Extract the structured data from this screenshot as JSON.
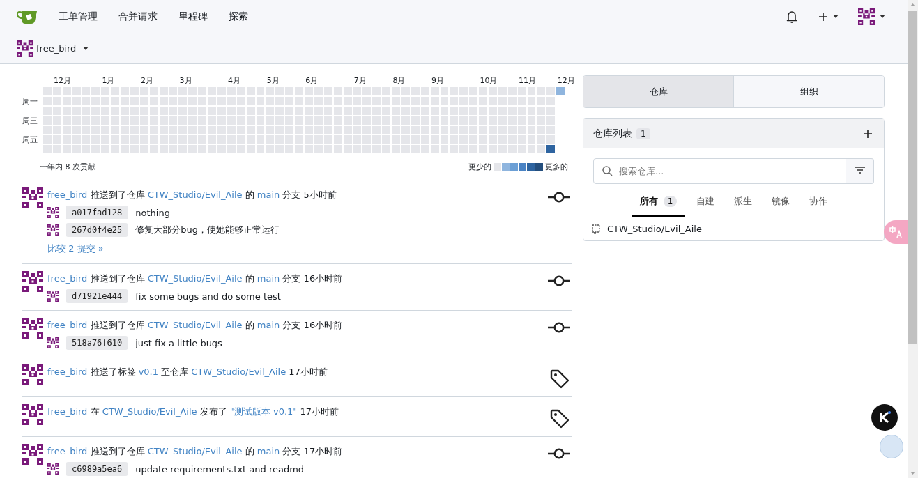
{
  "nav": {
    "items": [
      "工单管理",
      "合并请求",
      "里程碑",
      "探索"
    ]
  },
  "context": {
    "user": "free_bird"
  },
  "heatmap": {
    "weekdays": [
      {
        "label": "周一"
      },
      {
        "label": "周三"
      },
      {
        "label": "周五"
      }
    ],
    "legend": [
      {
        "color": "#e5e6ea"
      },
      {
        "color": "#8fb5de"
      },
      {
        "color": "#6b9fd5"
      },
      {
        "color": "#4a83c4"
      },
      {
        "color": "#2e64a0"
      },
      {
        "color": "#244e7d"
      }
    ],
    "weeks": [
      {
        "cells": [
          {
            "color": "#e5e6ea"
          },
          {
            "color": "#e5e6ea"
          },
          {
            "color": "#e5e6ea"
          },
          {
            "color": "#e5e6ea"
          },
          {
            "color": "#e5e6ea"
          },
          {
            "color": "#e5e6ea"
          },
          {
            "color": "#e5e6ea"
          }
        ]
      },
      {
        "month": "12月",
        "cells": [
          {
            "color": "#e5e6ea"
          },
          {
            "color": "#e5e6ea"
          },
          {
            "color": "#e5e6ea"
          },
          {
            "color": "#e5e6ea"
          },
          {
            "color": "#e5e6ea"
          },
          {
            "color": "#e5e6ea"
          },
          {
            "color": "#e5e6ea"
          }
        ]
      },
      {
        "cells": [
          {
            "color": "#e5e6ea"
          },
          {
            "color": "#e5e6ea"
          },
          {
            "color": "#e5e6ea"
          },
          {
            "color": "#e5e6ea"
          },
          {
            "color": "#e5e6ea"
          },
          {
            "color": "#e5e6ea"
          },
          {
            "color": "#e5e6ea"
          }
        ]
      },
      {
        "cells": [
          {
            "color": "#e5e6ea"
          },
          {
            "color": "#e5e6ea"
          },
          {
            "color": "#e5e6ea"
          },
          {
            "color": "#e5e6ea"
          },
          {
            "color": "#e5e6ea"
          },
          {
            "color": "#e5e6ea"
          },
          {
            "color": "#e5e6ea"
          }
        ]
      },
      {
        "cells": [
          {
            "color": "#e5e6ea"
          },
          {
            "color": "#e5e6ea"
          },
          {
            "color": "#e5e6ea"
          },
          {
            "color": "#e5e6ea"
          },
          {
            "color": "#e5e6ea"
          },
          {
            "color": "#e5e6ea"
          },
          {
            "color": "#e5e6ea"
          }
        ]
      },
      {
        "cells": [
          {
            "color": "#e5e6ea"
          },
          {
            "color": "#e5e6ea"
          },
          {
            "color": "#e5e6ea"
          },
          {
            "color": "#e5e6ea"
          },
          {
            "color": "#e5e6ea"
          },
          {
            "color": "#e5e6ea"
          },
          {
            "color": "#e5e6ea"
          }
        ]
      },
      {
        "month": "1月",
        "cells": [
          {
            "color": "#e5e6ea"
          },
          {
            "color": "#e5e6ea"
          },
          {
            "color": "#e5e6ea"
          },
          {
            "color": "#e5e6ea"
          },
          {
            "color": "#e5e6ea"
          },
          {
            "color": "#e5e6ea"
          },
          {
            "color": "#e5e6ea"
          }
        ]
      },
      {
        "cells": [
          {
            "color": "#e5e6ea"
          },
          {
            "color": "#e5e6ea"
          },
          {
            "color": "#e5e6ea"
          },
          {
            "color": "#e5e6ea"
          },
          {
            "color": "#e5e6ea"
          },
          {
            "color": "#e5e6ea"
          },
          {
            "color": "#e5e6ea"
          }
        ]
      },
      {
        "cells": [
          {
            "color": "#e5e6ea"
          },
          {
            "color": "#e5e6ea"
          },
          {
            "color": "#e5e6ea"
          },
          {
            "color": "#e5e6ea"
          },
          {
            "color": "#e5e6ea"
          },
          {
            "color": "#e5e6ea"
          },
          {
            "color": "#e5e6ea"
          }
        ]
      },
      {
        "cells": [
          {
            "color": "#e5e6ea"
          },
          {
            "color": "#e5e6ea"
          },
          {
            "color": "#e5e6ea"
          },
          {
            "color": "#e5e6ea"
          },
          {
            "color": "#e5e6ea"
          },
          {
            "color": "#e5e6ea"
          },
          {
            "color": "#e5e6ea"
          }
        ]
      },
      {
        "month": "2月",
        "cells": [
          {
            "color": "#e5e6ea"
          },
          {
            "color": "#e5e6ea"
          },
          {
            "color": "#e5e6ea"
          },
          {
            "color": "#e5e6ea"
          },
          {
            "color": "#e5e6ea"
          },
          {
            "color": "#e5e6ea"
          },
          {
            "color": "#e5e6ea"
          }
        ]
      },
      {
        "cells": [
          {
            "color": "#e5e6ea"
          },
          {
            "color": "#e5e6ea"
          },
          {
            "color": "#e5e6ea"
          },
          {
            "color": "#e5e6ea"
          },
          {
            "color": "#e5e6ea"
          },
          {
            "color": "#e5e6ea"
          },
          {
            "color": "#e5e6ea"
          }
        ]
      },
      {
        "cells": [
          {
            "color": "#e5e6ea"
          },
          {
            "color": "#e5e6ea"
          },
          {
            "color": "#e5e6ea"
          },
          {
            "color": "#e5e6ea"
          },
          {
            "color": "#e5e6ea"
          },
          {
            "color": "#e5e6ea"
          },
          {
            "color": "#e5e6ea"
          }
        ]
      },
      {
        "cells": [
          {
            "color": "#e5e6ea"
          },
          {
            "color": "#e5e6ea"
          },
          {
            "color": "#e5e6ea"
          },
          {
            "color": "#e5e6ea"
          },
          {
            "color": "#e5e6ea"
          },
          {
            "color": "#e5e6ea"
          },
          {
            "color": "#e5e6ea"
          }
        ]
      },
      {
        "month": "3月",
        "cells": [
          {
            "color": "#e5e6ea"
          },
          {
            "color": "#e5e6ea"
          },
          {
            "color": "#e5e6ea"
          },
          {
            "color": "#e5e6ea"
          },
          {
            "color": "#e5e6ea"
          },
          {
            "color": "#e5e6ea"
          },
          {
            "color": "#e5e6ea"
          }
        ]
      },
      {
        "cells": [
          {
            "color": "#e5e6ea"
          },
          {
            "color": "#e5e6ea"
          },
          {
            "color": "#e5e6ea"
          },
          {
            "color": "#e5e6ea"
          },
          {
            "color": "#e5e6ea"
          },
          {
            "color": "#e5e6ea"
          },
          {
            "color": "#e5e6ea"
          }
        ]
      },
      {
        "cells": [
          {
            "color": "#e5e6ea"
          },
          {
            "color": "#e5e6ea"
          },
          {
            "color": "#e5e6ea"
          },
          {
            "color": "#e5e6ea"
          },
          {
            "color": "#e5e6ea"
          },
          {
            "color": "#e5e6ea"
          },
          {
            "color": "#e5e6ea"
          }
        ]
      },
      {
        "cells": [
          {
            "color": "#e5e6ea"
          },
          {
            "color": "#e5e6ea"
          },
          {
            "color": "#e5e6ea"
          },
          {
            "color": "#e5e6ea"
          },
          {
            "color": "#e5e6ea"
          },
          {
            "color": "#e5e6ea"
          },
          {
            "color": "#e5e6ea"
          }
        ]
      },
      {
        "cells": [
          {
            "color": "#e5e6ea"
          },
          {
            "color": "#e5e6ea"
          },
          {
            "color": "#e5e6ea"
          },
          {
            "color": "#e5e6ea"
          },
          {
            "color": "#e5e6ea"
          },
          {
            "color": "#e5e6ea"
          },
          {
            "color": "#e5e6ea"
          }
        ]
      },
      {
        "month": "4月",
        "cells": [
          {
            "color": "#e5e6ea"
          },
          {
            "color": "#e5e6ea"
          },
          {
            "color": "#e5e6ea"
          },
          {
            "color": "#e5e6ea"
          },
          {
            "color": "#e5e6ea"
          },
          {
            "color": "#e5e6ea"
          },
          {
            "color": "#e5e6ea"
          }
        ]
      },
      {
        "cells": [
          {
            "color": "#e5e6ea"
          },
          {
            "color": "#e5e6ea"
          },
          {
            "color": "#e5e6ea"
          },
          {
            "color": "#e5e6ea"
          },
          {
            "color": "#e5e6ea"
          },
          {
            "color": "#e5e6ea"
          },
          {
            "color": "#e5e6ea"
          }
        ]
      },
      {
        "cells": [
          {
            "color": "#e5e6ea"
          },
          {
            "color": "#e5e6ea"
          },
          {
            "color": "#e5e6ea"
          },
          {
            "color": "#e5e6ea"
          },
          {
            "color": "#e5e6ea"
          },
          {
            "color": "#e5e6ea"
          },
          {
            "color": "#e5e6ea"
          }
        ]
      },
      {
        "cells": [
          {
            "color": "#e5e6ea"
          },
          {
            "color": "#e5e6ea"
          },
          {
            "color": "#e5e6ea"
          },
          {
            "color": "#e5e6ea"
          },
          {
            "color": "#e5e6ea"
          },
          {
            "color": "#e5e6ea"
          },
          {
            "color": "#e5e6ea"
          }
        ]
      },
      {
        "month": "5月",
        "cells": [
          {
            "color": "#e5e6ea"
          },
          {
            "color": "#e5e6ea"
          },
          {
            "color": "#e5e6ea"
          },
          {
            "color": "#e5e6ea"
          },
          {
            "color": "#e5e6ea"
          },
          {
            "color": "#e5e6ea"
          },
          {
            "color": "#e5e6ea"
          }
        ]
      },
      {
        "cells": [
          {
            "color": "#e5e6ea"
          },
          {
            "color": "#e5e6ea"
          },
          {
            "color": "#e5e6ea"
          },
          {
            "color": "#e5e6ea"
          },
          {
            "color": "#e5e6ea"
          },
          {
            "color": "#e5e6ea"
          },
          {
            "color": "#e5e6ea"
          }
        ]
      },
      {
        "cells": [
          {
            "color": "#e5e6ea"
          },
          {
            "color": "#e5e6ea"
          },
          {
            "color": "#e5e6ea"
          },
          {
            "color": "#e5e6ea"
          },
          {
            "color": "#e5e6ea"
          },
          {
            "color": "#e5e6ea"
          },
          {
            "color": "#e5e6ea"
          }
        ]
      },
      {
        "cells": [
          {
            "color": "#e5e6ea"
          },
          {
            "color": "#e5e6ea"
          },
          {
            "color": "#e5e6ea"
          },
          {
            "color": "#e5e6ea"
          },
          {
            "color": "#e5e6ea"
          },
          {
            "color": "#e5e6ea"
          },
          {
            "color": "#e5e6ea"
          }
        ]
      },
      {
        "month": "6月",
        "cells": [
          {
            "color": "#e5e6ea"
          },
          {
            "color": "#e5e6ea"
          },
          {
            "color": "#e5e6ea"
          },
          {
            "color": "#e5e6ea"
          },
          {
            "color": "#e5e6ea"
          },
          {
            "color": "#e5e6ea"
          },
          {
            "color": "#e5e6ea"
          }
        ]
      },
      {
        "cells": [
          {
            "color": "#e5e6ea"
          },
          {
            "color": "#e5e6ea"
          },
          {
            "color": "#e5e6ea"
          },
          {
            "color": "#e5e6ea"
          },
          {
            "color": "#e5e6ea"
          },
          {
            "color": "#e5e6ea"
          },
          {
            "color": "#e5e6ea"
          }
        ]
      },
      {
        "cells": [
          {
            "color": "#e5e6ea"
          },
          {
            "color": "#e5e6ea"
          },
          {
            "color": "#e5e6ea"
          },
          {
            "color": "#e5e6ea"
          },
          {
            "color": "#e5e6ea"
          },
          {
            "color": "#e5e6ea"
          },
          {
            "color": "#e5e6ea"
          }
        ]
      },
      {
        "cells": [
          {
            "color": "#e5e6ea"
          },
          {
            "color": "#e5e6ea"
          },
          {
            "color": "#e5e6ea"
          },
          {
            "color": "#e5e6ea"
          },
          {
            "color": "#e5e6ea"
          },
          {
            "color": "#e5e6ea"
          },
          {
            "color": "#e5e6ea"
          }
        ]
      },
      {
        "cells": [
          {
            "color": "#e5e6ea"
          },
          {
            "color": "#e5e6ea"
          },
          {
            "color": "#e5e6ea"
          },
          {
            "color": "#e5e6ea"
          },
          {
            "color": "#e5e6ea"
          },
          {
            "color": "#e5e6ea"
          },
          {
            "color": "#e5e6ea"
          }
        ]
      },
      {
        "month": "7月",
        "cells": [
          {
            "color": "#e5e6ea"
          },
          {
            "color": "#e5e6ea"
          },
          {
            "color": "#e5e6ea"
          },
          {
            "color": "#e5e6ea"
          },
          {
            "color": "#e5e6ea"
          },
          {
            "color": "#e5e6ea"
          },
          {
            "color": "#e5e6ea"
          }
        ]
      },
      {
        "cells": [
          {
            "color": "#e5e6ea"
          },
          {
            "color": "#e5e6ea"
          },
          {
            "color": "#e5e6ea"
          },
          {
            "color": "#e5e6ea"
          },
          {
            "color": "#e5e6ea"
          },
          {
            "color": "#e5e6ea"
          },
          {
            "color": "#e5e6ea"
          }
        ]
      },
      {
        "cells": [
          {
            "color": "#e5e6ea"
          },
          {
            "color": "#e5e6ea"
          },
          {
            "color": "#e5e6ea"
          },
          {
            "color": "#e5e6ea"
          },
          {
            "color": "#e5e6ea"
          },
          {
            "color": "#e5e6ea"
          },
          {
            "color": "#e5e6ea"
          }
        ]
      },
      {
        "cells": [
          {
            "color": "#e5e6ea"
          },
          {
            "color": "#e5e6ea"
          },
          {
            "color": "#e5e6ea"
          },
          {
            "color": "#e5e6ea"
          },
          {
            "color": "#e5e6ea"
          },
          {
            "color": "#e5e6ea"
          },
          {
            "color": "#e5e6ea"
          }
        ]
      },
      {
        "month": "8月",
        "cells": [
          {
            "color": "#e5e6ea"
          },
          {
            "color": "#e5e6ea"
          },
          {
            "color": "#e5e6ea"
          },
          {
            "color": "#e5e6ea"
          },
          {
            "color": "#e5e6ea"
          },
          {
            "color": "#e5e6ea"
          },
          {
            "color": "#e5e6ea"
          }
        ]
      },
      {
        "cells": [
          {
            "color": "#e5e6ea"
          },
          {
            "color": "#e5e6ea"
          },
          {
            "color": "#e5e6ea"
          },
          {
            "color": "#e5e6ea"
          },
          {
            "color": "#e5e6ea"
          },
          {
            "color": "#e5e6ea"
          },
          {
            "color": "#e5e6ea"
          }
        ]
      },
      {
        "cells": [
          {
            "color": "#e5e6ea"
          },
          {
            "color": "#e5e6ea"
          },
          {
            "color": "#e5e6ea"
          },
          {
            "color": "#e5e6ea"
          },
          {
            "color": "#e5e6ea"
          },
          {
            "color": "#e5e6ea"
          },
          {
            "color": "#e5e6ea"
          }
        ]
      },
      {
        "cells": [
          {
            "color": "#e5e6ea"
          },
          {
            "color": "#e5e6ea"
          },
          {
            "color": "#e5e6ea"
          },
          {
            "color": "#e5e6ea"
          },
          {
            "color": "#e5e6ea"
          },
          {
            "color": "#e5e6ea"
          },
          {
            "color": "#e5e6ea"
          }
        ]
      },
      {
        "month": "9月",
        "cells": [
          {
            "color": "#e5e6ea"
          },
          {
            "color": "#e5e6ea"
          },
          {
            "color": "#e5e6ea"
          },
          {
            "color": "#e5e6ea"
          },
          {
            "color": "#e5e6ea"
          },
          {
            "color": "#e5e6ea"
          },
          {
            "color": "#e5e6ea"
          }
        ]
      },
      {
        "cells": [
          {
            "color": "#e5e6ea"
          },
          {
            "color": "#e5e6ea"
          },
          {
            "color": "#e5e6ea"
          },
          {
            "color": "#e5e6ea"
          },
          {
            "color": "#e5e6ea"
          },
          {
            "color": "#e5e6ea"
          },
          {
            "color": "#e5e6ea"
          }
        ]
      },
      {
        "cells": [
          {
            "color": "#e5e6ea"
          },
          {
            "color": "#e5e6ea"
          },
          {
            "color": "#e5e6ea"
          },
          {
            "color": "#e5e6ea"
          },
          {
            "color": "#e5e6ea"
          },
          {
            "color": "#e5e6ea"
          },
          {
            "color": "#e5e6ea"
          }
        ]
      },
      {
        "cells": [
          {
            "color": "#e5e6ea"
          },
          {
            "color": "#e5e6ea"
          },
          {
            "color": "#e5e6ea"
          },
          {
            "color": "#e5e6ea"
          },
          {
            "color": "#e5e6ea"
          },
          {
            "color": "#e5e6ea"
          },
          {
            "color": "#e5e6ea"
          }
        ]
      },
      {
        "cells": [
          {
            "color": "#e5e6ea"
          },
          {
            "color": "#e5e6ea"
          },
          {
            "color": "#e5e6ea"
          },
          {
            "color": "#e5e6ea"
          },
          {
            "color": "#e5e6ea"
          },
          {
            "color": "#e5e6ea"
          },
          {
            "color": "#e5e6ea"
          }
        ]
      },
      {
        "month": "10月",
        "cells": [
          {
            "color": "#e5e6ea"
          },
          {
            "color": "#e5e6ea"
          },
          {
            "color": "#e5e6ea"
          },
          {
            "color": "#e5e6ea"
          },
          {
            "color": "#e5e6ea"
          },
          {
            "color": "#e5e6ea"
          },
          {
            "color": "#e5e6ea"
          }
        ]
      },
      {
        "cells": [
          {
            "color": "#e5e6ea"
          },
          {
            "color": "#e5e6ea"
          },
          {
            "color": "#e5e6ea"
          },
          {
            "color": "#e5e6ea"
          },
          {
            "color": "#e5e6ea"
          },
          {
            "color": "#e5e6ea"
          },
          {
            "color": "#e5e6ea"
          }
        ]
      },
      {
        "cells": [
          {
            "color": "#e5e6ea"
          },
          {
            "color": "#e5e6ea"
          },
          {
            "color": "#e5e6ea"
          },
          {
            "color": "#e5e6ea"
          },
          {
            "color": "#e5e6ea"
          },
          {
            "color": "#e5e6ea"
          },
          {
            "color": "#e5e6ea"
          }
        ]
      },
      {
        "cells": [
          {
            "color": "#e5e6ea"
          },
          {
            "color": "#e5e6ea"
          },
          {
            "color": "#e5e6ea"
          },
          {
            "color": "#e5e6ea"
          },
          {
            "color": "#e5e6ea"
          },
          {
            "color": "#e5e6ea"
          },
          {
            "color": "#e5e6ea"
          }
        ]
      },
      {
        "month": "11月",
        "cells": [
          {
            "color": "#e5e6ea"
          },
          {
            "color": "#e5e6ea"
          },
          {
            "color": "#e5e6ea"
          },
          {
            "color": "#e5e6ea"
          },
          {
            "color": "#e5e6ea"
          },
          {
            "color": "#e5e6ea"
          },
          {
            "color": "#e5e6ea"
          }
        ]
      },
      {
        "cells": [
          {
            "color": "#e5e6ea"
          },
          {
            "color": "#e5e6ea"
          },
          {
            "color": "#e5e6ea"
          },
          {
            "color": "#e5e6ea"
          },
          {
            "color": "#e5e6ea"
          },
          {
            "color": "#e5e6ea"
          },
          {
            "color": "#e5e6ea"
          }
        ]
      },
      {
        "cells": [
          {
            "color": "#e5e6ea"
          },
          {
            "color": "#e5e6ea"
          },
          {
            "color": "#e5e6ea"
          },
          {
            "color": "#e5e6ea"
          },
          {
            "color": "#e5e6ea"
          },
          {
            "color": "#e5e6ea"
          },
          {
            "color": "#e5e6ea"
          }
        ]
      },
      {
        "cells": [
          {
            "color": "#e5e6ea"
          },
          {
            "color": "#e5e6ea"
          },
          {
            "color": "#e5e6ea"
          },
          {
            "color": "#e5e6ea"
          },
          {
            "color": "#e5e6ea"
          },
          {
            "color": "#e5e6ea"
          },
          {
            "color": "#2e64a0"
          }
        ]
      },
      {
        "month": "12月",
        "cells": [
          {
            "color": "#8fb5de"
          }
        ]
      }
    ],
    "summary": "一年内 8 次贡献",
    "less": "更少的",
    "more": "更多的"
  },
  "feed": [
    {
      "kind": "commit",
      "parts": [
        {
          "kind": "link",
          "text": "free_bird"
        },
        {
          "kind": "text",
          "text": "推送到了仓库"
        },
        {
          "kind": "link",
          "text": "CTW_Studio/Evil_Aile"
        },
        {
          "kind": "text",
          "text": "的"
        },
        {
          "kind": "link",
          "text": "main"
        },
        {
          "kind": "text",
          "text": "分支"
        }
      ],
      "time": "5小时前",
      "commits": [
        {
          "sha": "a017fad128",
          "message": "nothing"
        },
        {
          "sha": "267d0f4e25",
          "message": "修复大部分bug，使她能够正常运行"
        }
      ],
      "compare": "比较 2 提交 »"
    },
    {
      "kind": "commit",
      "parts": [
        {
          "kind": "link",
          "text": "free_bird"
        },
        {
          "kind": "text",
          "text": "推送到了仓库"
        },
        {
          "kind": "link",
          "text": "CTW_Studio/Evil_Aile"
        },
        {
          "kind": "text",
          "text": "的"
        },
        {
          "kind": "link",
          "text": "main"
        },
        {
          "kind": "text",
          "text": "分支"
        }
      ],
      "time": "16小时前",
      "commits": [
        {
          "sha": "d71921e444",
          "message": "fix some bugs and do some test"
        }
      ]
    },
    {
      "kind": "commit",
      "parts": [
        {
          "kind": "link",
          "text": "free_bird"
        },
        {
          "kind": "text",
          "text": "推送到了仓库"
        },
        {
          "kind": "link",
          "text": "CTW_Studio/Evil_Aile"
        },
        {
          "kind": "text",
          "text": "的"
        },
        {
          "kind": "link",
          "text": "main"
        },
        {
          "kind": "text",
          "text": "分支"
        }
      ],
      "time": "16小时前",
      "commits": [
        {
          "sha": "518a76f610",
          "message": "just fix a little bugs"
        }
      ]
    },
    {
      "kind": "tag",
      "parts": [
        {
          "kind": "link",
          "text": "free_bird"
        },
        {
          "kind": "text",
          "text": "推送了标签"
        },
        {
          "kind": "link",
          "text": "v0.1"
        },
        {
          "kind": "text",
          "text": "至仓库"
        },
        {
          "kind": "link",
          "text": "CTW_Studio/Evil_Aile"
        }
      ],
      "time": "17小时前"
    },
    {
      "kind": "tag",
      "parts": [
        {
          "kind": "link",
          "text": "free_bird"
        },
        {
          "kind": "text",
          "text": "在"
        },
        {
          "kind": "link",
          "text": "CTW_Studio/Evil_Aile"
        },
        {
          "kind": "text",
          "text": "发布了"
        },
        {
          "kind": "release",
          "text": "\"测试版本 v0.1\""
        }
      ],
      "time": "17小时前"
    },
    {
      "kind": "commit",
      "parts": [
        {
          "kind": "link",
          "text": "free_bird"
        },
        {
          "kind": "text",
          "text": "推送到了仓库"
        },
        {
          "kind": "link",
          "text": "CTW_Studio/Evil_Aile"
        },
        {
          "kind": "text",
          "text": "的"
        },
        {
          "kind": "link",
          "text": "main"
        },
        {
          "kind": "text",
          "text": "分支"
        }
      ],
      "time": "17小时前",
      "commits": [
        {
          "sha": "c6989a5ea6",
          "message": "update requirements.txt and readmd"
        }
      ]
    }
  ],
  "sidebar": {
    "tabs": [
      {
        "label": "仓库",
        "selected": true
      },
      {
        "label": "组织",
        "selected": false
      }
    ],
    "repos": {
      "title": "仓库列表",
      "count": "1",
      "search": {
        "placeholder": "搜索仓库..."
      },
      "filters": [
        {
          "label": "所有",
          "count": "1",
          "selected": true
        },
        {
          "label": "自建",
          "selected": false
        },
        {
          "label": "派生",
          "selected": false
        },
        {
          "label": "镜像",
          "selected": false
        },
        {
          "label": "协作",
          "selected": false
        }
      ],
      "items": [
        {
          "name": "CTW_Studio/Evil_Aile"
        }
      ]
    }
  }
}
